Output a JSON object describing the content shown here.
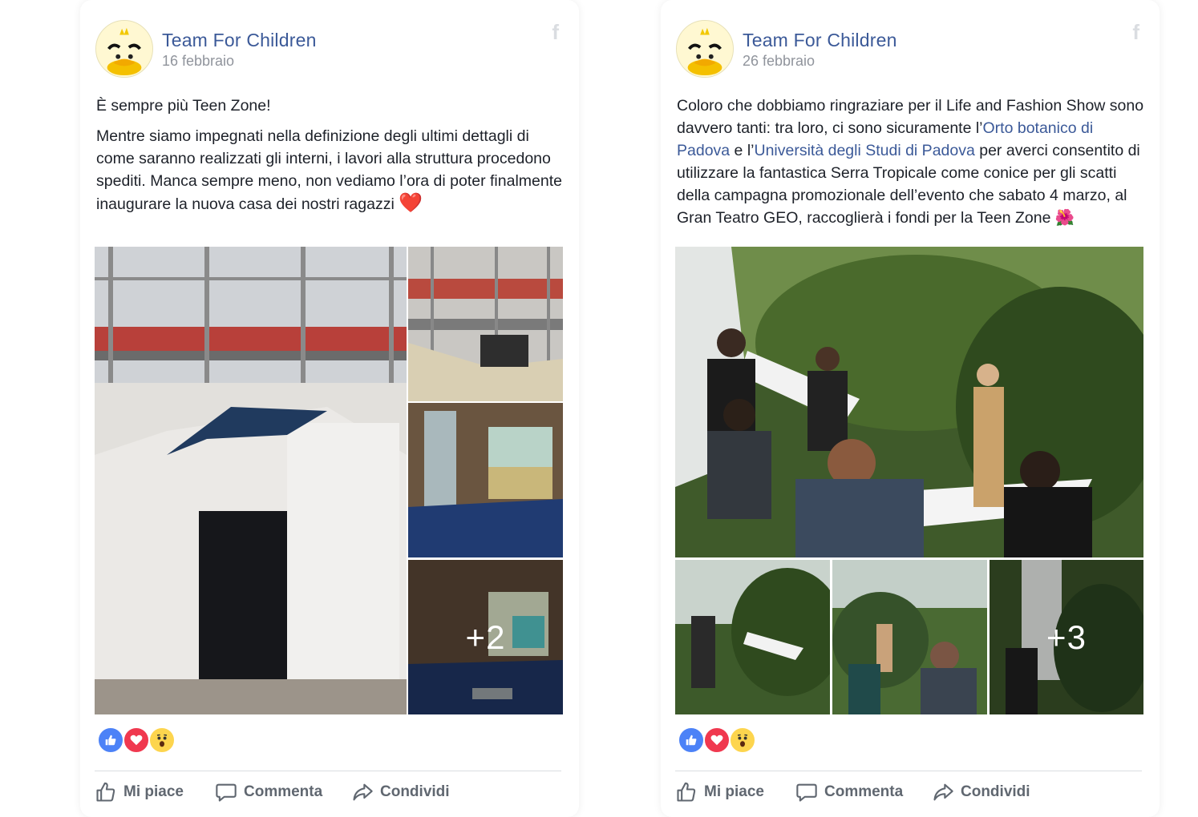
{
  "posts": [
    {
      "page_name": "Team For Children",
      "date": "16 febbraio",
      "title": "È sempre più Teen Zone!",
      "body": "Mentre siamo impegnati nella definizione degli ultimi dettagli di come saranno realizzati gli interni, i lavori alla struttura procedono spediti. Manca sempre meno, non vediamo l’ora di poter finalmente inaugurare la nuova casa dei nostri ragazzi",
      "body_emoji": "❤️",
      "more_photos": "+2",
      "actions": {
        "like": "Mi piace",
        "comment": "Commenta",
        "share": "Condividi"
      }
    },
    {
      "page_name": "Team For Children",
      "date": "26 febbraio",
      "body_parts": {
        "before_link1": "Coloro che dobbiamo ringraziare per il Life and Fashion Show sono davvero tanti: tra loro, ci sono sicuramente l’",
        "link1": "Orto botanico di Padova",
        "between": " e l’",
        "link2": "Università degli Studi di Padova",
        "after": " per averci consentito di utilizzare la fantastica Serra Tropicale come conice per gli scatti della campagna promozionale dell’evento che sabato 4 marzo, al Gran Teatro GEO, raccoglierà i fondi per la Teen Zone",
        "emoji": "🌺"
      },
      "more_photos": "+3",
      "actions": {
        "like": "Mi piace",
        "comment": "Commenta",
        "share": "Condividi"
      }
    }
  ],
  "icons": {
    "avatar": "duck-logo-icon",
    "platform": "facebook-icon",
    "reactions": [
      "like-reaction-icon",
      "love-reaction-icon",
      "wow-reaction-icon"
    ]
  },
  "colors": {
    "page_name": "#3b5998",
    "link": "#3b5998",
    "like": "#4c82f7",
    "love": "#f0384f",
    "wow": "#fdd54e"
  }
}
